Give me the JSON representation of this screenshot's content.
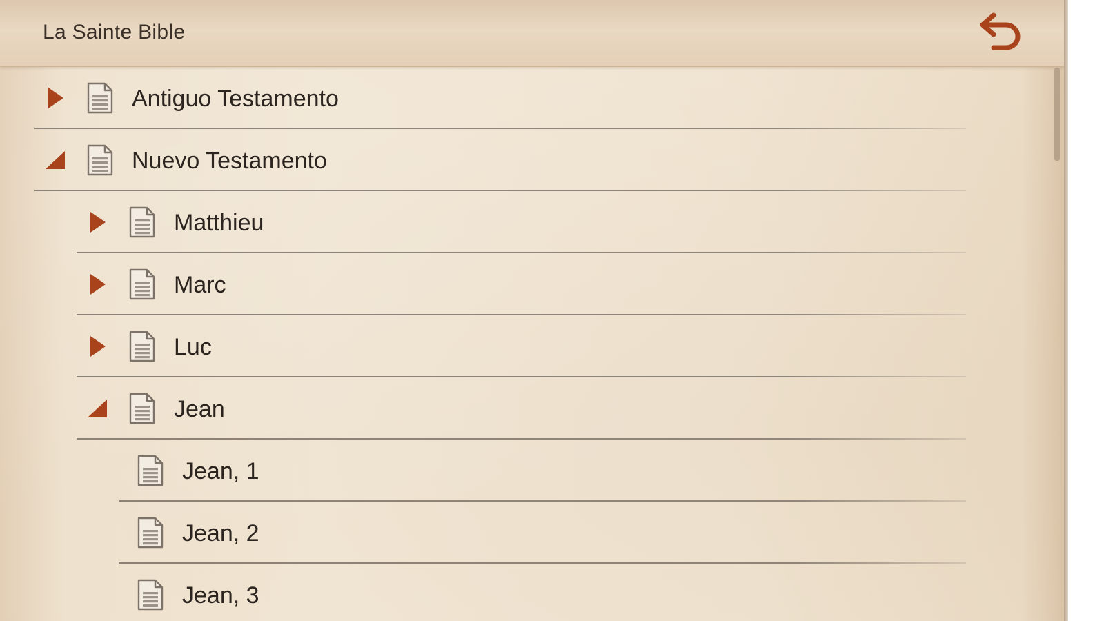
{
  "header": {
    "title": "La Sainte Bible",
    "back_icon": "undo-arrow-icon"
  },
  "colors": {
    "accent": "#a8431c",
    "text": "#2c241f",
    "background": "#f0e4d1"
  },
  "tree": {
    "items": [
      {
        "label": "Antiguo Testamento",
        "level": 0,
        "state": "collapsed"
      },
      {
        "label": "Nuevo Testamento",
        "level": 0,
        "state": "expanded"
      },
      {
        "label": "Matthieu",
        "level": 1,
        "state": "collapsed"
      },
      {
        "label": "Marc",
        "level": 1,
        "state": "collapsed"
      },
      {
        "label": "Luc",
        "level": 1,
        "state": "collapsed"
      },
      {
        "label": "Jean",
        "level": 1,
        "state": "expanded"
      },
      {
        "label": "Jean, 1",
        "level": 2,
        "state": "leaf"
      },
      {
        "label": "Jean, 2",
        "level": 2,
        "state": "leaf"
      },
      {
        "label": "Jean, 3",
        "level": 2,
        "state": "leaf"
      }
    ]
  }
}
